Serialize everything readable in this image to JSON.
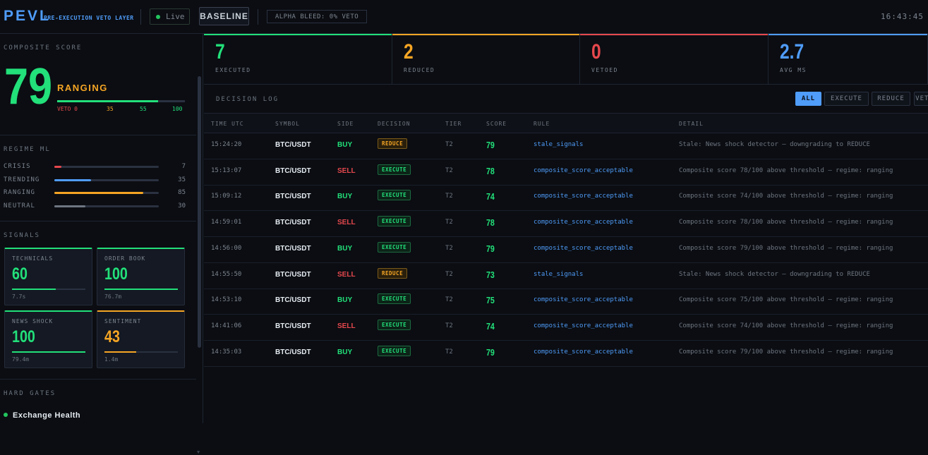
{
  "header": {
    "logo": "PEVL",
    "subtitle": "PRE-EXECUTION VETO LAYER",
    "live_label": "Live",
    "baseline_label": "BASELINE",
    "alpha_bleed": "ALPHA BLEED: 0% VETO",
    "clock": "16:43:45"
  },
  "composite": {
    "title": "COMPOSITE SCORE",
    "score": "79",
    "regime": "RANGING",
    "score_fraction": 0.79,
    "ticks": [
      "VETO 0",
      "35",
      "55",
      "100"
    ]
  },
  "regime_ml": {
    "title": "REGIME ML",
    "items": [
      {
        "label": "CRISIS",
        "value": "7",
        "fraction": 0.07,
        "color": "#e5484d"
      },
      {
        "label": "TRENDING",
        "value": "35",
        "fraction": 0.35,
        "color": "#4f9cf9"
      },
      {
        "label": "RANGING",
        "value": "85",
        "fraction": 0.85,
        "color": "#f5a524"
      },
      {
        "label": "NEUTRAL",
        "value": "30",
        "fraction": 0.3,
        "color": "#6e7681"
      }
    ]
  },
  "signals": {
    "title": "SIGNALS",
    "cards": [
      {
        "label": "TECHNICALS",
        "value": "60",
        "sub": "7.7s",
        "fraction": 0.6,
        "color": "#22e07a"
      },
      {
        "label": "ORDER BOOK",
        "value": "100",
        "sub": "76.7m",
        "fraction": 1.0,
        "color": "#22e07a"
      },
      {
        "label": "NEWS SHOCK",
        "value": "100",
        "sub": "79.4m",
        "fraction": 1.0,
        "color": "#22e07a"
      },
      {
        "label": "SENTIMENT",
        "value": "43",
        "sub": "1.4m",
        "fraction": 0.43,
        "color": "#f5a524"
      }
    ]
  },
  "hard_gates": {
    "title": "HARD GATES",
    "items": [
      {
        "label": "Exchange Health"
      }
    ]
  },
  "metrics": [
    {
      "value": "7",
      "label": "EXECUTED",
      "color": "#22e07a"
    },
    {
      "value": "2",
      "label": "REDUCED",
      "color": "#f5a524"
    },
    {
      "value": "0",
      "label": "VETOED",
      "color": "#e5484d"
    },
    {
      "value": "2.7",
      "label": "AVG MS",
      "color": "#4f9cf9"
    }
  ],
  "log": {
    "title": "DECISION LOG",
    "filters": [
      "ALL",
      "EXECUTE",
      "REDUCE",
      "VETO"
    ],
    "columns": [
      "TIME UTC",
      "SYMBOL",
      "SIDE",
      "DECISION",
      "TIER",
      "SCORE",
      "RULE",
      "DETAIL"
    ],
    "rows": [
      {
        "time": "15:24:20",
        "symbol": "BTC/USDT",
        "side": "BUY",
        "decision": "REDUCE",
        "tier": "T2",
        "score": "79",
        "rule": "stale_signals",
        "detail": "Stale: News shock detector — downgrading to REDUCE"
      },
      {
        "time": "15:13:07",
        "symbol": "BTC/USDT",
        "side": "SELL",
        "decision": "EXECUTE",
        "tier": "T2",
        "score": "78",
        "rule": "composite_score_acceptable",
        "detail": "Composite score 78/100 above threshold — regime: ranging"
      },
      {
        "time": "15:09:12",
        "symbol": "BTC/USDT",
        "side": "BUY",
        "decision": "EXECUTE",
        "tier": "T2",
        "score": "74",
        "rule": "composite_score_acceptable",
        "detail": "Composite score 74/100 above threshold — regime: ranging"
      },
      {
        "time": "14:59:01",
        "symbol": "BTC/USDT",
        "side": "SELL",
        "decision": "EXECUTE",
        "tier": "T2",
        "score": "78",
        "rule": "composite_score_acceptable",
        "detail": "Composite score 78/100 above threshold — regime: ranging"
      },
      {
        "time": "14:56:00",
        "symbol": "BTC/USDT",
        "side": "BUY",
        "decision": "EXECUTE",
        "tier": "T2",
        "score": "79",
        "rule": "composite_score_acceptable",
        "detail": "Composite score 79/100 above threshold — regime: ranging"
      },
      {
        "time": "14:55:50",
        "symbol": "BTC/USDT",
        "side": "SELL",
        "decision": "REDUCE",
        "tier": "T2",
        "score": "73",
        "rule": "stale_signals",
        "detail": "Stale: News shock detector — downgrading to REDUCE"
      },
      {
        "time": "14:53:10",
        "symbol": "BTC/USDT",
        "side": "BUY",
        "decision": "EXECUTE",
        "tier": "T2",
        "score": "75",
        "rule": "composite_score_acceptable",
        "detail": "Composite score 75/100 above threshold — regime: ranging"
      },
      {
        "time": "14:41:06",
        "symbol": "BTC/USDT",
        "side": "SELL",
        "decision": "EXECUTE",
        "tier": "T2",
        "score": "74",
        "rule": "composite_score_acceptable",
        "detail": "Composite score 74/100 above threshold — regime: ranging"
      },
      {
        "time": "14:35:03",
        "symbol": "BTC/USDT",
        "side": "BUY",
        "decision": "EXECUTE",
        "tier": "T2",
        "score": "79",
        "rule": "composite_score_acceptable",
        "detail": "Composite score 79/100 above threshold — regime: ranging"
      }
    ]
  },
  "colors": {
    "green": "#22e07a",
    "amber": "#f5a524",
    "red": "#e5484d",
    "blue": "#4f9cf9"
  }
}
